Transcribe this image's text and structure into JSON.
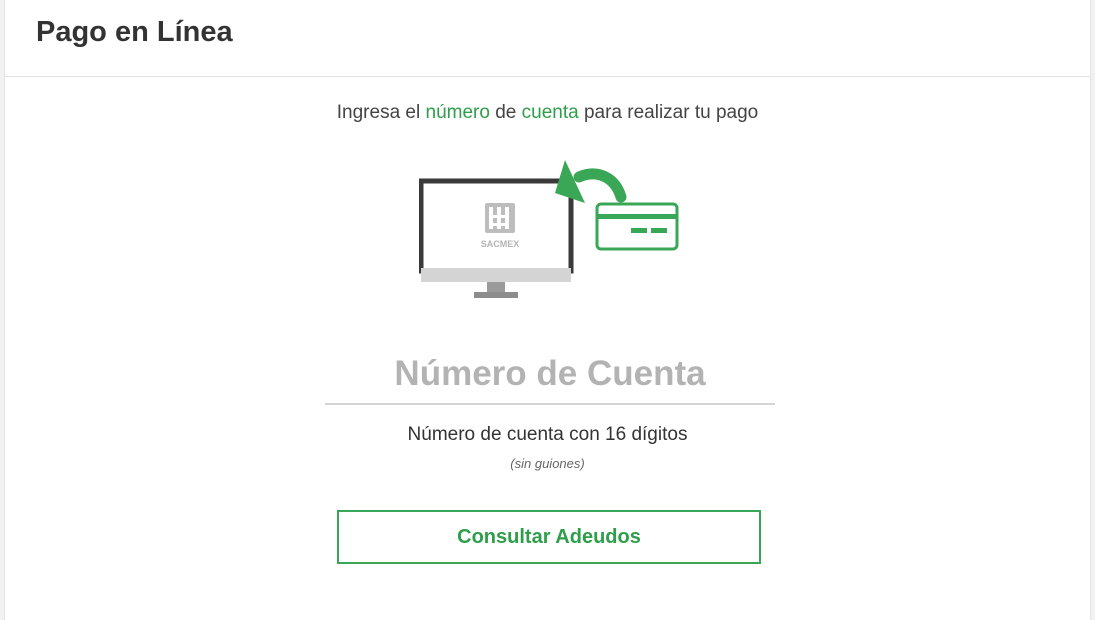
{
  "header": {
    "title": "Pago en Línea"
  },
  "intro": {
    "part1": "Ingresa el ",
    "highlight1": "número",
    "part2": " de ",
    "highlight2": "cuenta",
    "part3": " para realizar tu pago"
  },
  "illustration": {
    "monitor_logo_text": "SACMEX",
    "icons": [
      "computer-monitor-icon",
      "curved-arrow-icon",
      "credit-card-icon"
    ],
    "colors": {
      "accent": "#3aa757",
      "monitor_frame": "#3a3a3a",
      "monitor_stand": "#8c8c8c"
    }
  },
  "form": {
    "account_placeholder": "Número de Cuenta",
    "account_value": "",
    "helper_text": "Número de cuenta con 16 dígitos",
    "helper_note": "(sin guiones)",
    "submit_label": "Consultar Adeudos"
  },
  "colors": {
    "accent": "#2e9e4a",
    "title": "#333333",
    "placeholder": "#b3b3b3"
  }
}
